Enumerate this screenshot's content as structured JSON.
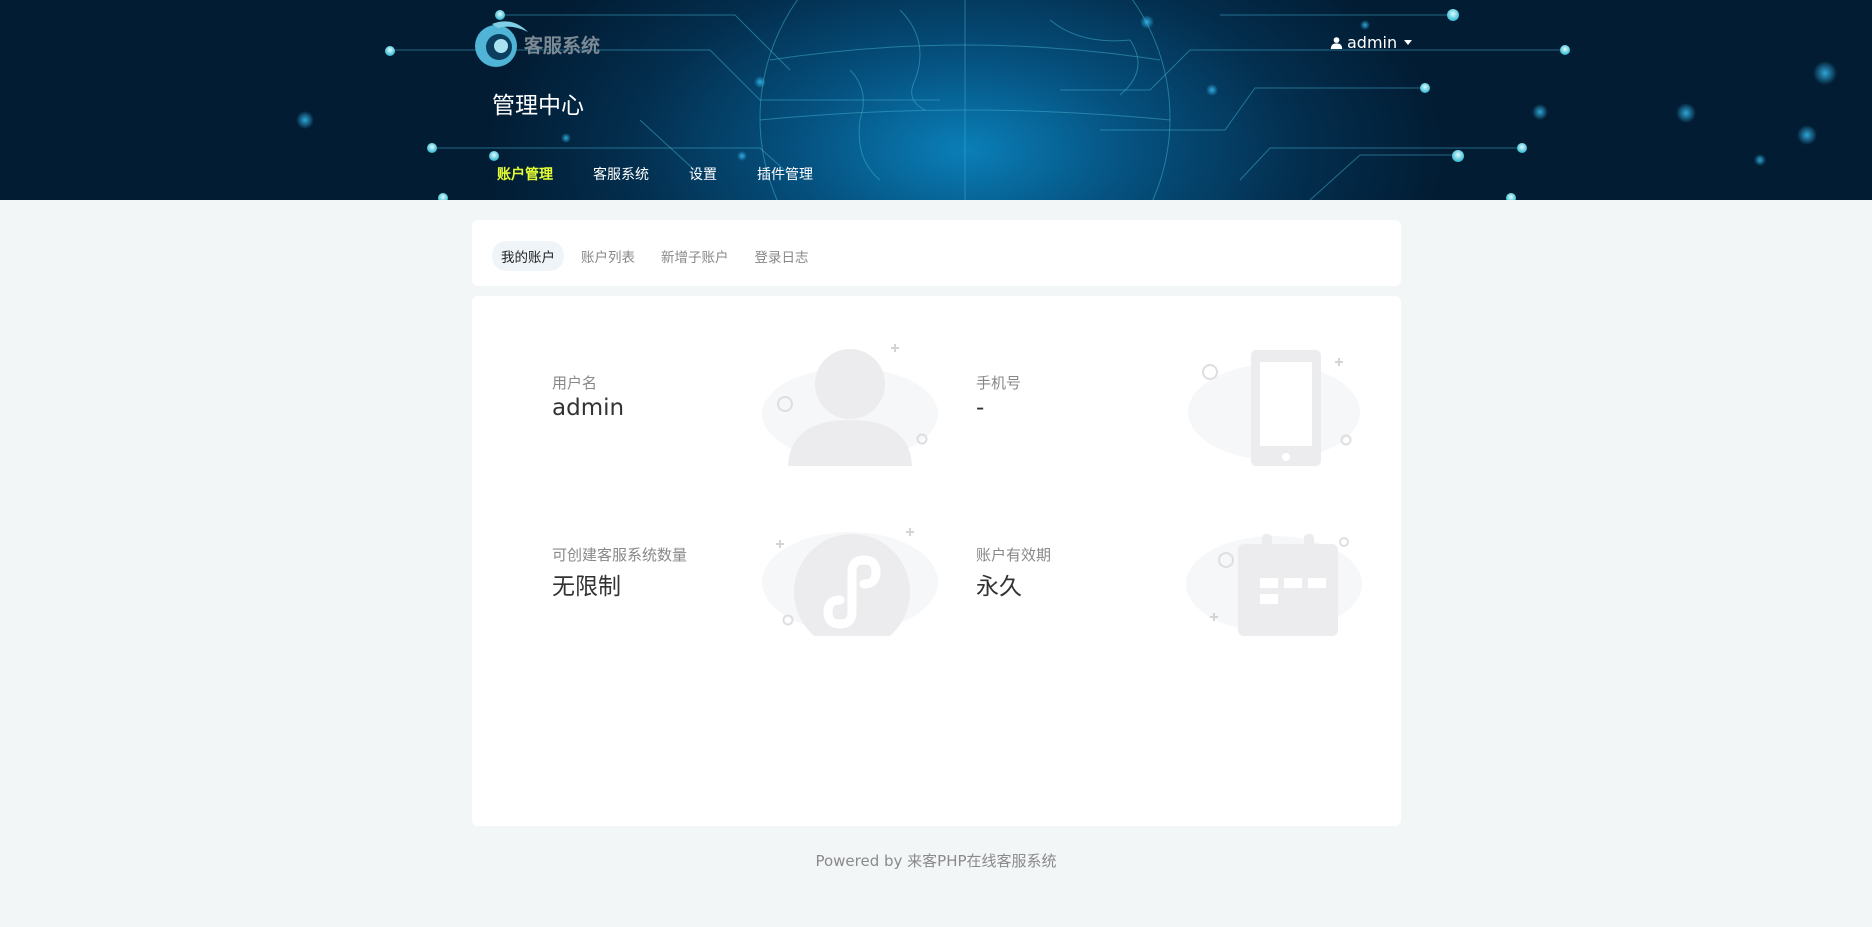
{
  "brand": {
    "logo_text": "客服系统"
  },
  "header": {
    "title": "管理中心",
    "user_name": "admin"
  },
  "topnav": [
    {
      "label": "账户管理",
      "active": true
    },
    {
      "label": "客服系统",
      "active": false
    },
    {
      "label": "设置",
      "active": false
    },
    {
      "label": "插件管理",
      "active": false
    }
  ],
  "tabs": [
    {
      "label": "我的账户",
      "active": true
    },
    {
      "label": "账户列表",
      "active": false
    },
    {
      "label": "新增子账户",
      "active": false
    },
    {
      "label": "登录日志",
      "active": false
    }
  ],
  "account": {
    "username": {
      "label": "用户名",
      "value": "admin",
      "icon": "user-icon"
    },
    "phone": {
      "label": "手机号",
      "value": "-",
      "icon": "phone-icon"
    },
    "quota": {
      "label": "可创建客服系统数量",
      "value": "无限制",
      "icon": "mini-program-icon"
    },
    "expiry": {
      "label": "账户有效期",
      "value": "永久",
      "icon": "calendar-icon"
    }
  },
  "footer": {
    "text": "Powered by 来客PHP在线客服系统"
  },
  "colors": {
    "nav_active": "#e6ff33",
    "banner_dark": "#021c33",
    "banner_glow": "#0a7fb8"
  }
}
